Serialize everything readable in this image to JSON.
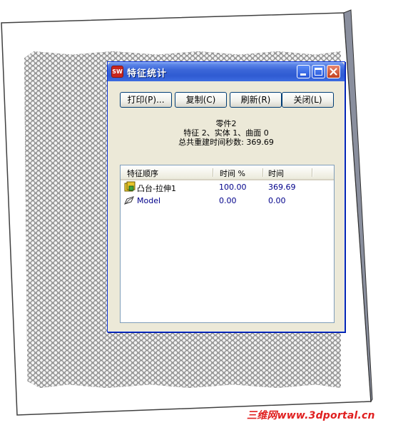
{
  "dialog": {
    "title": "特征统计",
    "app_icon_text": "SW",
    "buttons": {
      "print": "打印(P)...",
      "copy": "复制(C)",
      "refresh": "刷新(R)",
      "close": "关闭(L)"
    },
    "part_name": "零件2",
    "summary": "特征 2、实体 1、曲面 0",
    "rebuild_time": "总共重建时间秒数: 369.69",
    "columns": [
      "特征顺序",
      "时间 %",
      "时间"
    ],
    "rows": [
      {
        "name": "凸台-拉伸1",
        "percent": "100.00",
        "time": "369.69",
        "icon": "boss-extrude-icon"
      },
      {
        "name": "Model",
        "percent": "0.00",
        "time": "0.00",
        "icon": "sketch-model-icon"
      }
    ]
  },
  "watermark": "三维网www.3dportal.cn",
  "colors": {
    "titlebar": "#2f5bd2",
    "dialog_bg": "#ece9d8",
    "close_button": "#c2401e",
    "number_text": "#00008a",
    "watermark": "#e02020"
  }
}
